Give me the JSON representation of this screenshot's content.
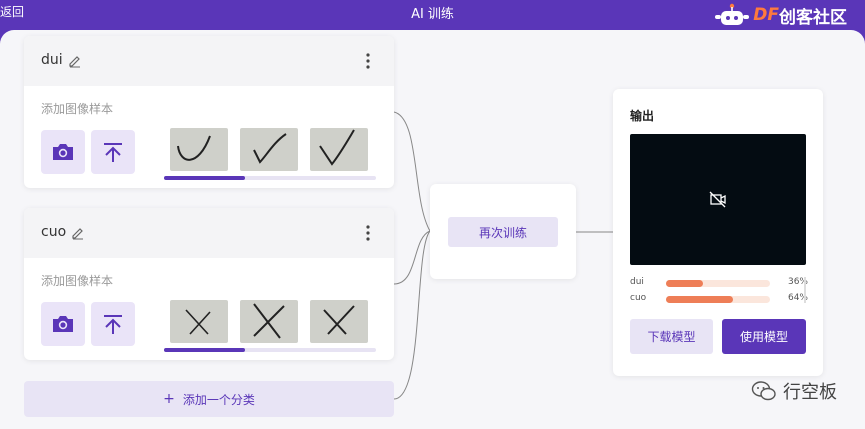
{
  "topbar": {
    "back_label": "返回",
    "title": "AI 训练",
    "brand_df": "DF",
    "brand_name": "创客社区"
  },
  "classes": [
    {
      "name": "dui",
      "samples_label": "添加图像样本",
      "progress": 0.38
    },
    {
      "name": "cuo",
      "samples_label": "添加图像样本",
      "progress": 0.38
    }
  ],
  "add_class_label": "添加一个分类",
  "train": {
    "retrain_label": "再次训练"
  },
  "output": {
    "title": "输出",
    "results": [
      {
        "label": "dui",
        "percent": 36,
        "percent_text": "36%"
      },
      {
        "label": "cuo",
        "percent": 64,
        "percent_text": "64%"
      }
    ],
    "download_label": "下载模型",
    "use_label": "使用模型"
  },
  "watermark": "行空板",
  "colors": {
    "accent": "#5a36b8",
    "accent_light": "#e8e4f5",
    "bar": "#ee7e57",
    "bar_track": "#fbe6dc",
    "preview_bg": "#040c12"
  },
  "icons": [
    "edit-icon",
    "more-vertical-icon",
    "camera-icon",
    "upload-icon",
    "camera-off-icon",
    "wechat-icon"
  ]
}
